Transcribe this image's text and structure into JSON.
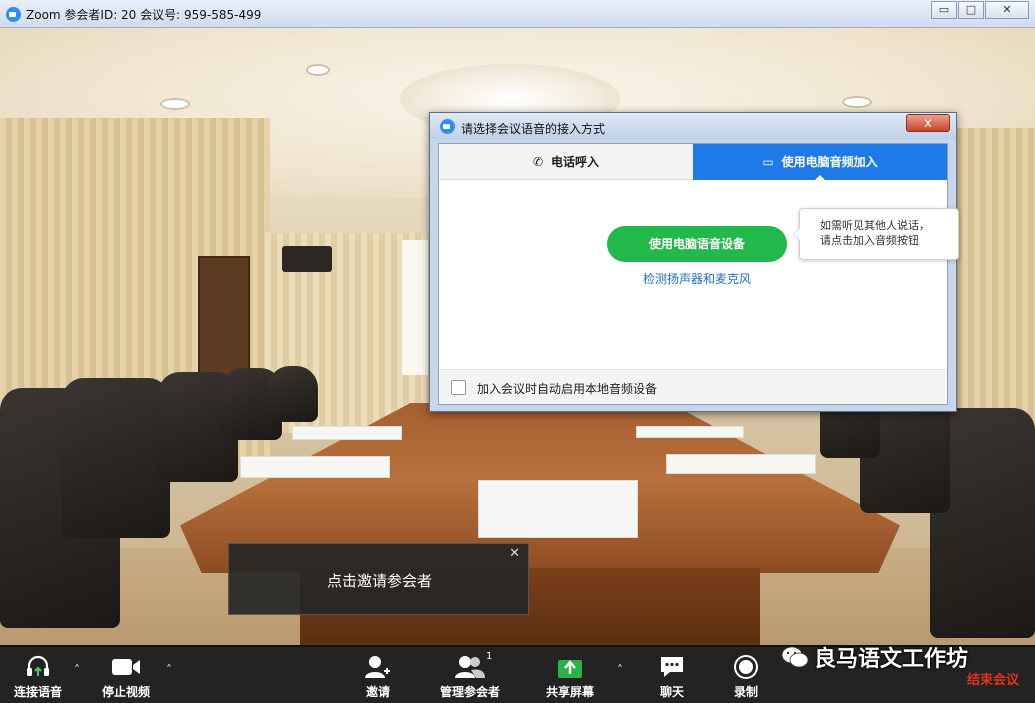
{
  "window": {
    "title": "Zoom 参会者ID: 20   会议号: 959-585-499",
    "controls": [
      "▭",
      "□",
      "✕"
    ]
  },
  "audio_dialog": {
    "title": "请选择会议语音的接入方式",
    "close_label": "x",
    "tabs": [
      {
        "label": "电话呼入",
        "icon": "phone-icon",
        "active": false
      },
      {
        "label": "使用电脑音频加入",
        "icon": "laptop-icon",
        "active": true
      }
    ],
    "join_button_label": "使用电脑语音设备",
    "test_link_label": "检测扬声器和麦克风",
    "tooltip_line1": "如需听见其他人说话，",
    "tooltip_line2": "请点击加入音频按钮",
    "auto_join_checkbox_label": "加入会议时自动启用本地音频设备",
    "auto_join_checked": false
  },
  "invite_popup": {
    "message": "点击邀请参会者",
    "close_label": "✕"
  },
  "toolbar": {
    "connect_audio": "连接语音",
    "stop_video": "停止视频",
    "invite": "邀请",
    "manage_participants": "管理参会者",
    "participant_count": "1",
    "share_screen": "共享屏幕",
    "chat": "聊天",
    "record": "录制",
    "end_meeting": "结束会议"
  },
  "watermark": "良马语文工作坊",
  "colors": {
    "accent_blue": "#1f7ae8",
    "join_green": "#22b94a",
    "share_green": "#2ab24a",
    "end_red": "#e0321f"
  }
}
